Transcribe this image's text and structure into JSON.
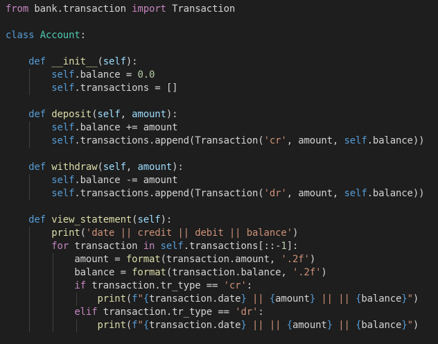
{
  "editor": {
    "language": "python",
    "theme": {
      "background": "#1e1e1e",
      "text": "#d4d4d4",
      "keyword_control": "#c586c0",
      "keyword": "#569cd6",
      "class_name": "#4ec9b0",
      "function": "#dcdcaa",
      "parameter": "#9cdcfe",
      "string": "#ce9178",
      "number": "#b5cea8",
      "indent_guide": "#404040"
    },
    "lines": [
      {
        "indent": 0,
        "tokens": [
          [
            "kw-ctrl",
            "from"
          ],
          [
            "plain",
            " bank.transaction "
          ],
          [
            "kw-ctrl",
            "import"
          ],
          [
            "plain",
            " Transaction"
          ]
        ]
      },
      {
        "indent": 0,
        "tokens": []
      },
      {
        "indent": 0,
        "tokens": [
          [
            "kw",
            "class"
          ],
          [
            "plain",
            " "
          ],
          [
            "cls",
            "Account"
          ],
          [
            "plain",
            ":"
          ]
        ]
      },
      {
        "indent": 1,
        "tokens": []
      },
      {
        "indent": 1,
        "tokens": [
          [
            "kw",
            "def"
          ],
          [
            "plain",
            " "
          ],
          [
            "func",
            "__init__"
          ],
          [
            "plain",
            "("
          ],
          [
            "param",
            "self"
          ],
          [
            "plain",
            "):"
          ]
        ]
      },
      {
        "indent": 2,
        "tokens": [
          [
            "self",
            "self"
          ],
          [
            "plain",
            ".balance = "
          ],
          [
            "num",
            "0.0"
          ]
        ]
      },
      {
        "indent": 2,
        "tokens": [
          [
            "self",
            "self"
          ],
          [
            "plain",
            ".transactions = []"
          ]
        ]
      },
      {
        "indent": 1,
        "tokens": []
      },
      {
        "indent": 1,
        "tokens": [
          [
            "kw",
            "def"
          ],
          [
            "plain",
            " "
          ],
          [
            "func",
            "deposit"
          ],
          [
            "plain",
            "("
          ],
          [
            "param",
            "self"
          ],
          [
            "plain",
            ", "
          ],
          [
            "param",
            "amount"
          ],
          [
            "plain",
            "):"
          ]
        ]
      },
      {
        "indent": 2,
        "tokens": [
          [
            "self",
            "self"
          ],
          [
            "plain",
            ".balance += amount"
          ]
        ]
      },
      {
        "indent": 2,
        "tokens": [
          [
            "self",
            "self"
          ],
          [
            "plain",
            ".transactions.append(Transaction("
          ],
          [
            "str",
            "'cr'"
          ],
          [
            "plain",
            ", amount, "
          ],
          [
            "self",
            "self"
          ],
          [
            "plain",
            ".balance))"
          ]
        ]
      },
      {
        "indent": 1,
        "tokens": []
      },
      {
        "indent": 1,
        "tokens": [
          [
            "kw",
            "def"
          ],
          [
            "plain",
            " "
          ],
          [
            "func",
            "withdraw"
          ],
          [
            "plain",
            "("
          ],
          [
            "param",
            "self"
          ],
          [
            "plain",
            ", "
          ],
          [
            "param",
            "amount"
          ],
          [
            "plain",
            "):"
          ]
        ]
      },
      {
        "indent": 2,
        "tokens": [
          [
            "self",
            "self"
          ],
          [
            "plain",
            ".balance -= amount"
          ]
        ]
      },
      {
        "indent": 2,
        "tokens": [
          [
            "self",
            "self"
          ],
          [
            "plain",
            ".transactions.append(Transaction("
          ],
          [
            "str",
            "'dr'"
          ],
          [
            "plain",
            ", amount, "
          ],
          [
            "self",
            "self"
          ],
          [
            "plain",
            ".balance))"
          ]
        ]
      },
      {
        "indent": 1,
        "tokens": []
      },
      {
        "indent": 1,
        "tokens": [
          [
            "kw",
            "def"
          ],
          [
            "plain",
            " "
          ],
          [
            "func",
            "view_statement"
          ],
          [
            "plain",
            "("
          ],
          [
            "param",
            "self"
          ],
          [
            "plain",
            "):"
          ]
        ]
      },
      {
        "indent": 2,
        "tokens": [
          [
            "func",
            "print"
          ],
          [
            "plain",
            "("
          ],
          [
            "str",
            "'date || credit || debit || balance'"
          ],
          [
            "plain",
            ")"
          ]
        ]
      },
      {
        "indent": 2,
        "tokens": [
          [
            "kw-ctrl",
            "for"
          ],
          [
            "plain",
            " transaction "
          ],
          [
            "kw-ctrl",
            "in"
          ],
          [
            "plain",
            " "
          ],
          [
            "self",
            "self"
          ],
          [
            "plain",
            ".transactions[::-"
          ],
          [
            "num",
            "1"
          ],
          [
            "plain",
            "]:"
          ]
        ]
      },
      {
        "indent": 3,
        "tokens": [
          [
            "plain",
            "amount = "
          ],
          [
            "func",
            "format"
          ],
          [
            "plain",
            "(transaction.amount, "
          ],
          [
            "str",
            "'.2f'"
          ],
          [
            "plain",
            ")"
          ]
        ]
      },
      {
        "indent": 3,
        "tokens": [
          [
            "plain",
            "balance = "
          ],
          [
            "func",
            "format"
          ],
          [
            "plain",
            "(transaction.balance, "
          ],
          [
            "str",
            "'.2f'"
          ],
          [
            "plain",
            ")"
          ]
        ]
      },
      {
        "indent": 3,
        "tokens": [
          [
            "kw-ctrl",
            "if"
          ],
          [
            "plain",
            " transaction.tr_type == "
          ],
          [
            "str",
            "'cr'"
          ],
          [
            "plain",
            ":"
          ]
        ]
      },
      {
        "indent": 4,
        "tokens": [
          [
            "func",
            "print"
          ],
          [
            "plain",
            "("
          ],
          [
            "kw",
            "f"
          ],
          [
            "str",
            "\""
          ],
          [
            "kw",
            "{"
          ],
          [
            "plain",
            "transaction.date"
          ],
          [
            "kw",
            "}"
          ],
          [
            "str",
            " || "
          ],
          [
            "kw",
            "{"
          ],
          [
            "plain",
            "amount"
          ],
          [
            "kw",
            "}"
          ],
          [
            "str",
            " || || "
          ],
          [
            "kw",
            "{"
          ],
          [
            "plain",
            "balance"
          ],
          [
            "kw",
            "}"
          ],
          [
            "str",
            "\""
          ],
          [
            "plain",
            ")"
          ]
        ]
      },
      {
        "indent": 3,
        "tokens": [
          [
            "kw-ctrl",
            "elif"
          ],
          [
            "plain",
            " transaction.tr_type == "
          ],
          [
            "str",
            "'dr'"
          ],
          [
            "plain",
            ":"
          ]
        ]
      },
      {
        "indent": 4,
        "tokens": [
          [
            "func",
            "print"
          ],
          [
            "plain",
            "("
          ],
          [
            "kw",
            "f"
          ],
          [
            "str",
            "\""
          ],
          [
            "kw",
            "{"
          ],
          [
            "plain",
            "transaction.date"
          ],
          [
            "kw",
            "}"
          ],
          [
            "str",
            " || || "
          ],
          [
            "kw",
            "{"
          ],
          [
            "plain",
            "amount"
          ],
          [
            "kw",
            "}"
          ],
          [
            "str",
            " || "
          ],
          [
            "kw",
            "{"
          ],
          [
            "plain",
            "balance"
          ],
          [
            "kw",
            "}"
          ],
          [
            "str",
            "\""
          ],
          [
            "plain",
            ")"
          ]
        ]
      }
    ]
  }
}
